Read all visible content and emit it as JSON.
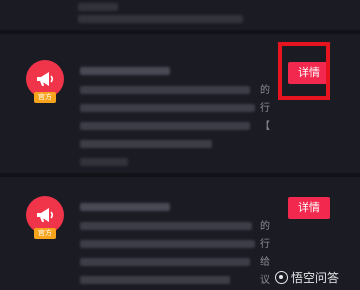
{
  "notifications": [
    {
      "badge_label": "官方",
      "detail_label": "详情",
      "side_chars": [
        "的",
        "行",
        "【"
      ],
      "highlighted": true
    },
    {
      "badge_label": "官方",
      "detail_label": "详情",
      "side_chars": [
        "的",
        "行",
        "给",
        "议"
      ],
      "highlighted": false
    }
  ],
  "watermark": {
    "text": "悟空问答",
    "icon": "wukong-logo-icon"
  },
  "colors": {
    "background": "#1b1b24",
    "avatar": "#f0344a",
    "badge": "#f7a41c",
    "detail_button": "#f3284f",
    "highlight": "#e5141f"
  }
}
